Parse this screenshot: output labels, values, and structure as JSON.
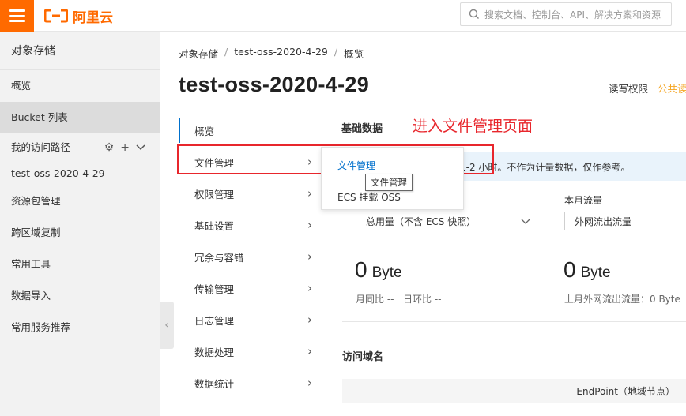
{
  "header": {
    "brand": "阿里云",
    "search_placeholder": "搜索文档、控制台、API、解决方案和资源"
  },
  "sidebar": {
    "title": "对象存储",
    "items": [
      {
        "label": "概览"
      },
      {
        "label": "Bucket 列表"
      }
    ],
    "section_label": "我的访问路径",
    "path_item": "test-oss-2020-4-29",
    "bottom_items": [
      {
        "label": "资源包管理"
      },
      {
        "label": "跨区域复制"
      },
      {
        "label": "常用工具"
      },
      {
        "label": "数据导入"
      },
      {
        "label": "常用服务推荐"
      }
    ]
  },
  "breadcrumb": [
    "对象存储",
    "test-oss-2020-4-29",
    "概览"
  ],
  "page_title": "test-oss-2020-4-29",
  "title_actions": {
    "permission": "读写权限",
    "public": "公共读"
  },
  "subnav": [
    {
      "label": "概览"
    },
    {
      "label": "文件管理"
    },
    {
      "label": "权限管理"
    },
    {
      "label": "基础设置"
    },
    {
      "label": "冗余与容错"
    },
    {
      "label": "传输管理"
    },
    {
      "label": "日志管理"
    },
    {
      "label": "数据处理"
    },
    {
      "label": "数据统计"
    }
  ],
  "main": {
    "section_title": "基础数据",
    "annotation": "进入文件管理页面",
    "notice": "1-2 小时。不作为计量数据，仅作参考。",
    "monthly_flow_label": "本月流量",
    "storage_select": "总用量（不含 ECS 快照）",
    "flow_select": "外网流出流量",
    "storage_value": "0",
    "storage_unit": "Byte",
    "flow_value": "0",
    "flow_unit": "Byte",
    "mom_label": "月同比",
    "mom_value": "--",
    "dod_label": "日环比",
    "dod_value": "--",
    "last_month_flow": "上月外网流出流量：0 Byte",
    "domain_section": "访问域名",
    "endpoint_header": "EndPoint（地域节点）"
  },
  "popup": {
    "items": [
      "文件管理",
      "ECS 挂载 OSS"
    ],
    "tooltip": "文件管理"
  },
  "colors": {
    "brand": "#ff6a00",
    "link": "#0070cc",
    "annotation": "#e8262c",
    "warn": "#f5a623"
  }
}
